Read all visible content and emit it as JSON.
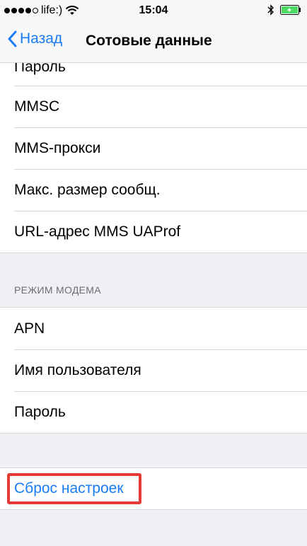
{
  "status_bar": {
    "carrier": "life:)",
    "time": "15:04",
    "signal_bars": 4,
    "icons": [
      "signal-dots-icon",
      "wifi-icon",
      "bluetooth-icon",
      "battery-charging-icon"
    ]
  },
  "nav": {
    "back_label": "Назад",
    "title": "Сотовые данные"
  },
  "mms_section": {
    "rows": [
      "Пароль",
      "MMSC",
      "MMS-прокси",
      "Макс. размер сообщ.",
      "URL-адрес MMS UAProf"
    ]
  },
  "modem_section": {
    "header": "РЕЖИМ МОДЕМА",
    "rows": [
      "APN",
      "Имя пользователя",
      "Пароль"
    ]
  },
  "reset": {
    "label": "Сброс настроек",
    "highlight_color": "#e53935"
  },
  "colors": {
    "accent": "#1a7cf5",
    "background": "#efeff4"
  }
}
